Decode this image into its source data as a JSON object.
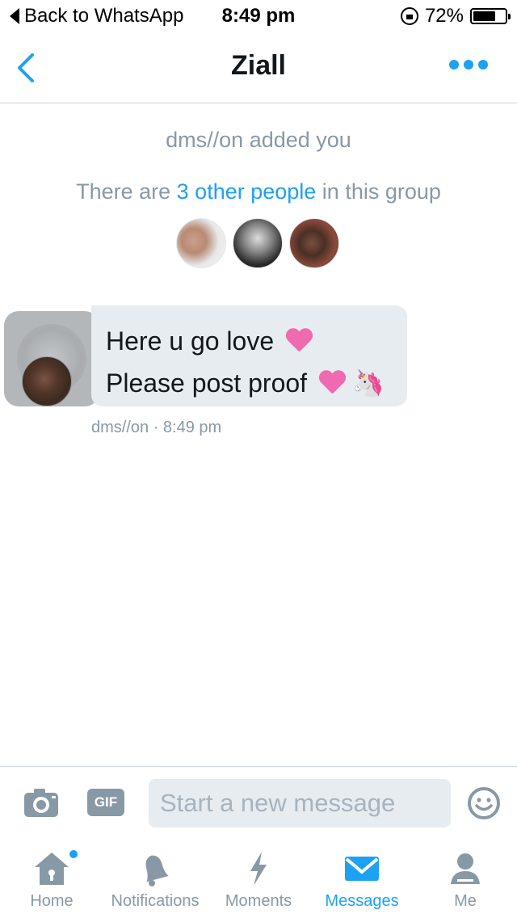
{
  "status_bar": {
    "back_label": "Back to WhatsApp",
    "time": "8:49 pm",
    "battery": "72%"
  },
  "nav": {
    "title": "Ziall"
  },
  "conversation": {
    "system_added": "dms//on added you",
    "system_group_prefix": "There are ",
    "system_group_link": "3 other people",
    "system_group_suffix": " in this group",
    "members": [
      "member-1",
      "member-2",
      "member-3"
    ],
    "message": {
      "line1": "Here u go love",
      "line2": "Please post proof",
      "line1_emoji": "heart-emoji",
      "line2_emoji": [
        "heart-emoji",
        "unicorn-emoji"
      ],
      "meta": "dms//on · 8:49 pm"
    }
  },
  "composer": {
    "gif_label": "GIF",
    "placeholder": "Start a new message"
  },
  "tabs": [
    {
      "label": "Home",
      "icon": "home-icon",
      "active": false,
      "badge": true
    },
    {
      "label": "Notifications",
      "icon": "bell-icon",
      "active": false
    },
    {
      "label": "Moments",
      "icon": "lightning-icon",
      "active": false
    },
    {
      "label": "Messages",
      "icon": "envelope-icon",
      "active": true
    },
    {
      "label": "Me",
      "icon": "person-icon",
      "active": false
    }
  ],
  "colors": {
    "accent": "#1da1f2",
    "muted": "#8899a6",
    "bubble": "#e6ecf0"
  }
}
